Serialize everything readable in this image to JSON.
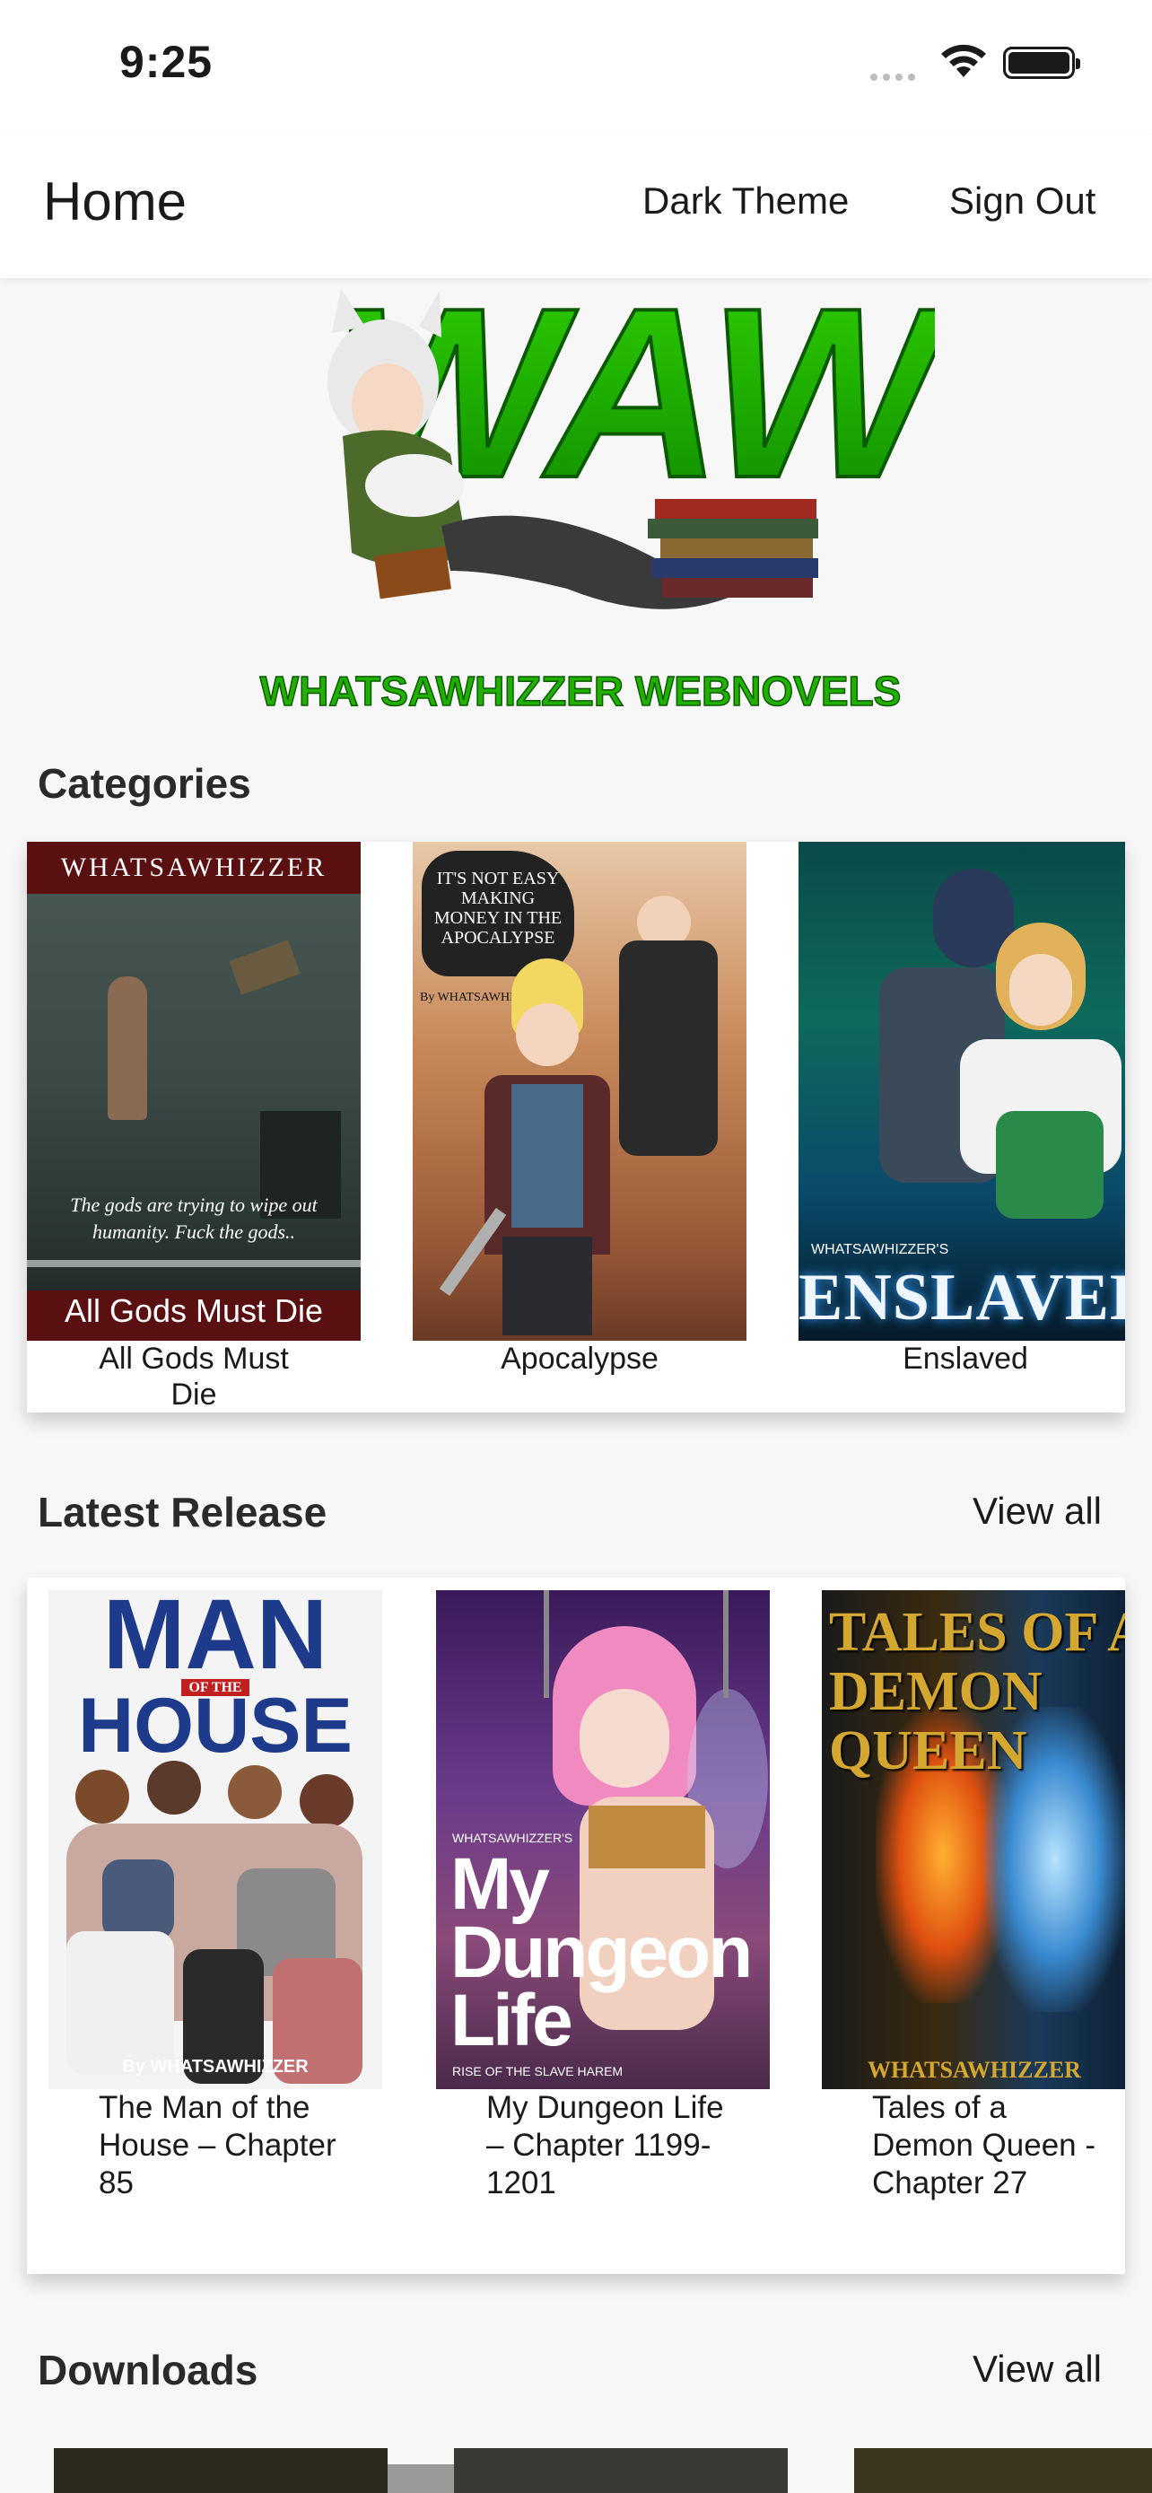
{
  "status_bar": {
    "time": "9:25"
  },
  "app_bar": {
    "title": "Home",
    "dark_theme_label": "Dark Theme",
    "sign_out_label": "Sign Out"
  },
  "banner": {
    "logo_text": "WAW",
    "tagline": "WHATSAWHIZZER WEBNOVELS"
  },
  "categories": {
    "title": "Categories",
    "items": [
      {
        "label": "All Gods Must Die",
        "cover_top": "WHATSAWHIZZER",
        "cover_quote": "The gods are trying to wipe out humanity. Fuck the gods..",
        "cover_bottom": "All Gods Must Die"
      },
      {
        "label": "Apocalypse",
        "cover_top": "IT'S NOT EASY MAKING MONEY IN THE APOCALYPSE",
        "cover_author": "By WHATSAWHIZZER"
      },
      {
        "label": "Enslaved",
        "cover_top": "WHATSAWHIZZER'S",
        "cover_bottom": "ENSLAVED"
      }
    ]
  },
  "latest_release": {
    "title": "Latest Release",
    "view_all_label": "View all",
    "items": [
      {
        "label": "The Man of the House – Chapter 85",
        "cover_title_1": "MAN",
        "cover_title_2": "OF THE",
        "cover_title_3": "HOUSE",
        "cover_author": "By WHATSAWHIZZER"
      },
      {
        "label": "My Dungeon Life – Chapter 1199-1201",
        "cover_author": "WHATSAWHIZZER'S",
        "cover_title": "My Dungeon Life",
        "cover_subtitle": "RISE OF THE SLAVE HAREM"
      },
      {
        "label": "Tales of a Demon Queen - Chapter 27",
        "cover_title": "TALES OF A DEMON QUEEN",
        "cover_author": "WHATSAWHIZZER"
      }
    ]
  },
  "downloads": {
    "title": "Downloads",
    "view_all_label": "View all"
  },
  "colors": {
    "accent_green": "#22b000",
    "background": "#f7f7f7"
  }
}
